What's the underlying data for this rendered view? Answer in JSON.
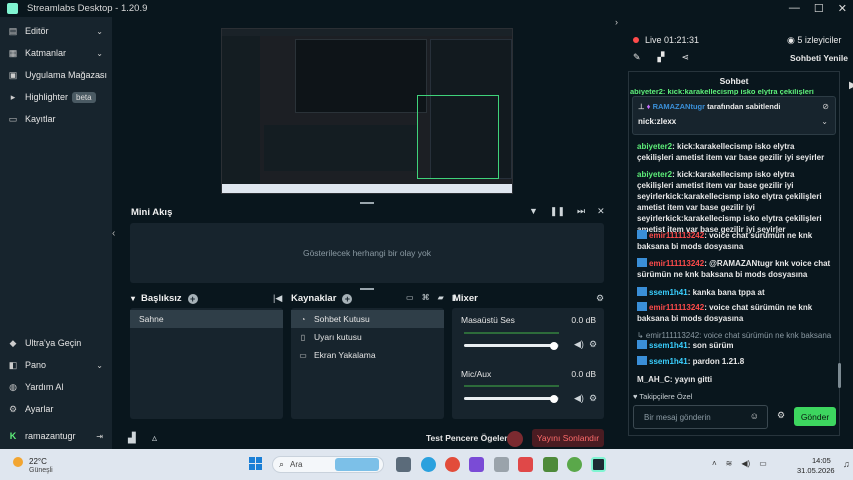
{
  "window": {
    "title": "Streamlabs Desktop - 1.20.9"
  },
  "sidebar": {
    "items": [
      {
        "label": "Editör",
        "icon": "editor-icon"
      },
      {
        "label": "Katmanlar",
        "icon": "layers-icon"
      },
      {
        "label": "Uygulama Mağazası",
        "icon": "store-icon"
      },
      {
        "label": "Highlighter",
        "icon": "highlighter-icon",
        "badge": "beta"
      },
      {
        "label": "Kayıtlar",
        "icon": "recordings-icon"
      }
    ],
    "bottom_items": [
      {
        "label": "Ultra'ya Geçin",
        "icon": "ultra-icon"
      },
      {
        "label": "Pano",
        "icon": "dashboard-icon"
      },
      {
        "label": "Yardım Al",
        "icon": "help-icon"
      },
      {
        "label": "Ayarlar",
        "icon": "settings-icon"
      }
    ],
    "user": "ramazantugr"
  },
  "mini_feed": {
    "title": "Mini Akış",
    "empty": "Gösterilecek herhangi bir olay yok"
  },
  "scenes": {
    "title": "Başlıksız",
    "items": [
      "Sahne"
    ]
  },
  "sources": {
    "title": "Kaynaklar",
    "items": [
      "Sohbet Kutusu",
      "Uyarı kutusu",
      "Ekran Yakalama"
    ]
  },
  "mixer": {
    "title": "Mixer",
    "channels": [
      {
        "name": "Masaüstü Ses",
        "db": "0.0 dB",
        "level": 0.95
      },
      {
        "name": "Mic/Aux",
        "db": "0.0 dB",
        "level": 0.95
      }
    ]
  },
  "footer": {
    "test_widgets": "Test Pencere Ögeleri",
    "end_stream": "Yayını Sonlandır"
  },
  "live": {
    "status": "Live",
    "time": "01:21:31",
    "viewers": "5 izleyiciler",
    "refresh": "Sohbeti Yenile"
  },
  "chat": {
    "title": "Sohbet",
    "pinned_by_user": "RAMAZANtugr",
    "pinned_by_suffix": "tarafından sabitlendi",
    "pinned_message": "nick:zlexx",
    "top_clipped": "abiyeter2: kick:karakellecismp isko elytra çekilişleri",
    "messages": [
      {
        "user": "abiyeter2",
        "color": "green",
        "badge": false,
        "text": ": kick:karakellecismp isko elytra çekilişleri ametist item var base gezilir iyi seyirler"
      },
      {
        "user": "abiyeter2",
        "color": "green",
        "badge": false,
        "text": ": kick:karakellecismp isko elytra çekilişleri ametist item var base gezilir iyi seyirlerkick:karakellecismp isko elytra çekilişleri ametist item var base gezilir iyi seyirlerkick:karakellecismp isko elytra çekilişleri ametist item var base gezilir iyi seyirler"
      },
      {
        "user": "emir111113242",
        "color": "red",
        "badge": true,
        "text": ": voice chat sürümün ne knk baksana bi mods dosyasına"
      },
      {
        "user": "emir111113242",
        "color": "red",
        "badge": true,
        "text": ": @RAMAZANtugr knk voice chat sürümün ne knk baksana bi mods dosyasına"
      },
      {
        "user": "ssem1h41",
        "color": "blue",
        "badge": true,
        "text": ": kanka bana tppa at"
      },
      {
        "user": "emir111113242",
        "color": "red",
        "badge": true,
        "text": ": voice chat sürümün ne knk baksana bi mods dosyasına"
      },
      {
        "user": "",
        "color": "grey",
        "badge": false,
        "text": "↳ emir111113242: voice chat sürümün ne knk baksana bi"
      },
      {
        "user": "ssem1h41",
        "color": "blue",
        "badge": true,
        "text": ": son sürüm"
      },
      {
        "user": "ssem1h41",
        "color": "blue",
        "badge": true,
        "text": ": pardon 1.21.8"
      },
      {
        "user": "M_AH_C",
        "color": "white",
        "badge": false,
        "text": ": yayın gitti"
      }
    ],
    "followers_only": "Takipçilere Özel",
    "input_placeholder": "Bir mesaj gönderin",
    "send": "Gönder"
  },
  "taskbar": {
    "weather_temp": "22°C",
    "weather_desc": "Güneşli",
    "search_placeholder": "Ara",
    "time": "14:05",
    "date": "31.05.2026"
  },
  "colors": {
    "accent": "#80f5d2",
    "live_red": "#ff4b4b",
    "send_green": "#3dd65f",
    "bg": "#09161d",
    "panel": "#17242d"
  }
}
